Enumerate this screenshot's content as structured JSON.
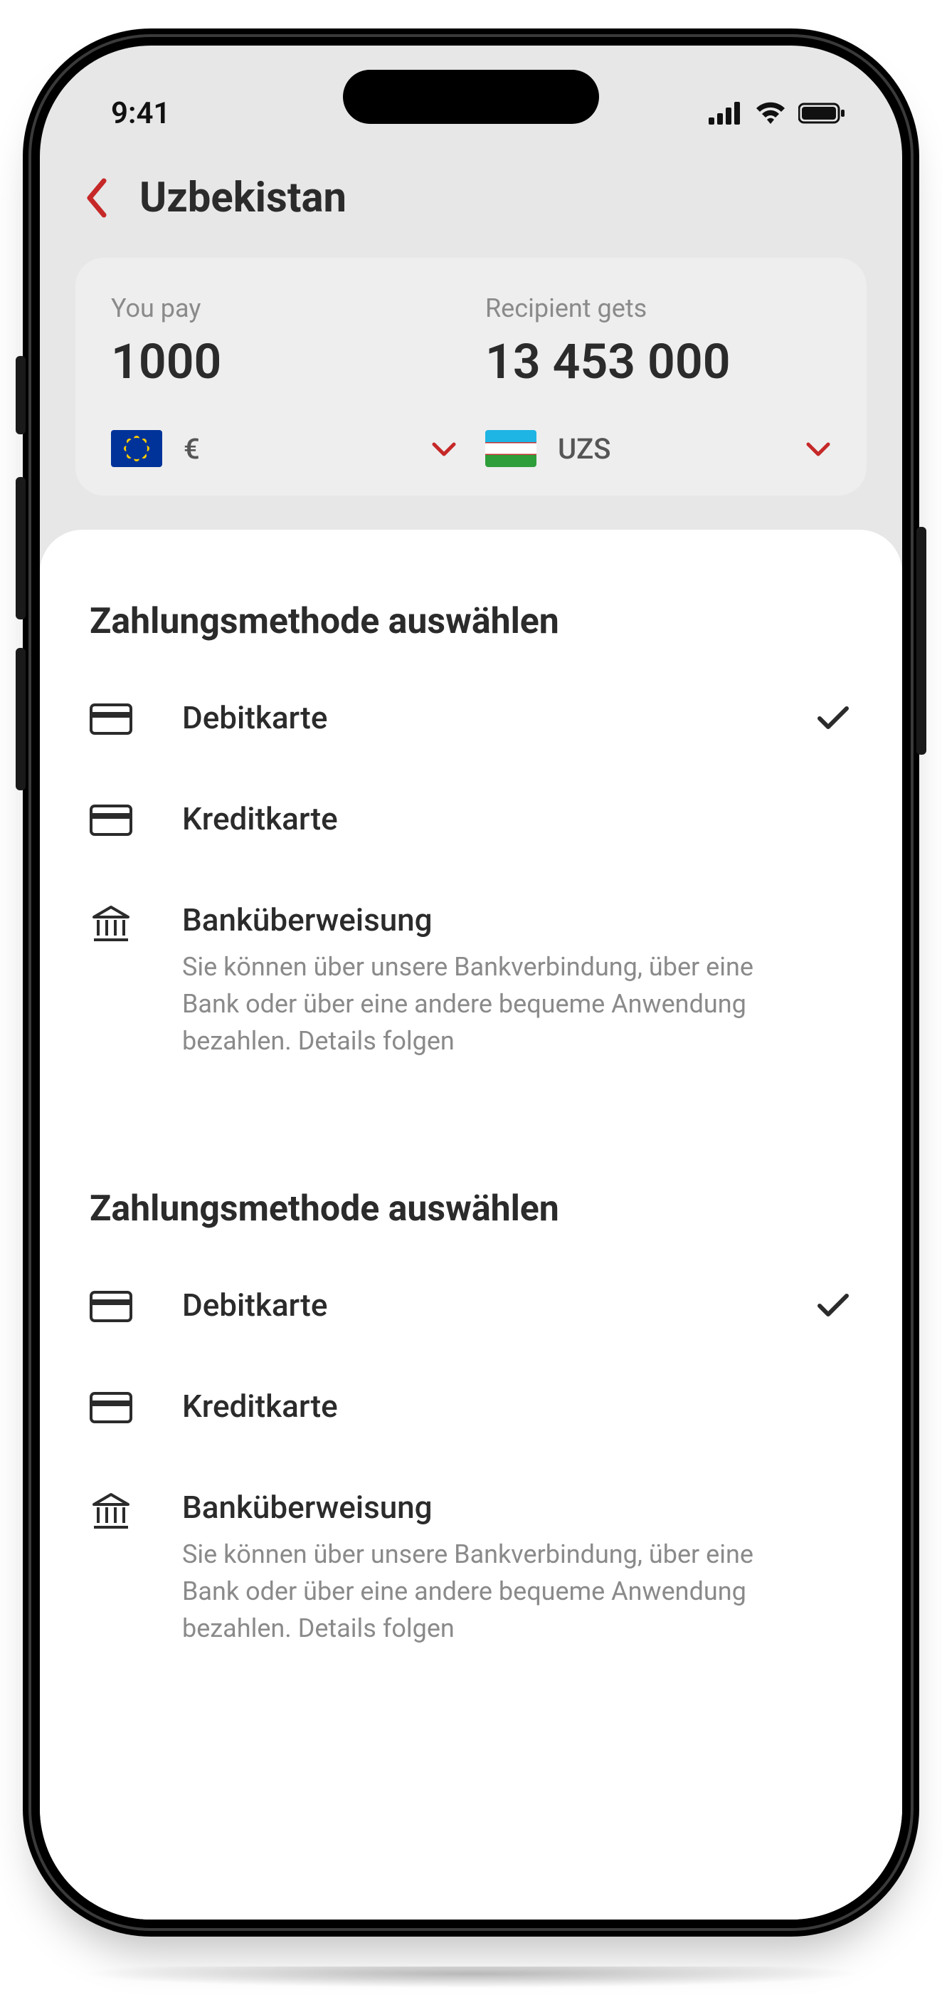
{
  "statusbar": {
    "time": "9:41"
  },
  "header": {
    "title": "Uzbekistan"
  },
  "amounts": {
    "pay_label": "You pay",
    "pay_value": "1000",
    "pay_currency": "€",
    "get_label": "Recipient gets",
    "get_value": "13 453 000",
    "get_currency": "UZS"
  },
  "sheet": {
    "sections": [
      {
        "title": "Zahlungsmethode auswählen",
        "options": [
          {
            "icon": "card",
            "title": "Debitkarte",
            "desc": "",
            "selected": true
          },
          {
            "icon": "card",
            "title": "Kreditkarte",
            "desc": "",
            "selected": false
          },
          {
            "icon": "bank",
            "title": "Banküberweisung",
            "desc": "Sie können über unsere Bankverbindung, über eine Bank oder über eine andere bequeme Anwendung bezahlen. Details folgen",
            "selected": false
          }
        ]
      },
      {
        "title": "Zahlungsmethode auswählen",
        "options": [
          {
            "icon": "card",
            "title": "Debitkarte",
            "desc": "",
            "selected": true
          },
          {
            "icon": "card",
            "title": "Kreditkarte",
            "desc": "",
            "selected": false
          },
          {
            "icon": "bank",
            "title": "Banküberweisung",
            "desc": "Sie können über unsere Bankverbindung, über eine Bank oder über eine andere bequeme Anwendung bezahlen. Details folgen",
            "selected": false
          }
        ]
      }
    ]
  }
}
